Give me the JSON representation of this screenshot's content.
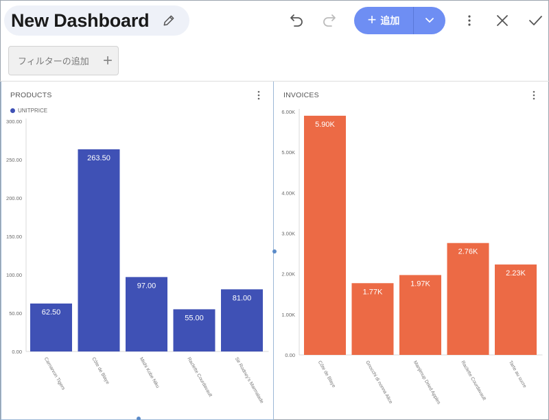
{
  "header": {
    "title": "New Dashboard",
    "add_label": "追加"
  },
  "filter": {
    "label": "フィルターの追加"
  },
  "colors": {
    "products_bar": "#3f51b5",
    "invoices_bar": "#ec6a45",
    "accent": "#6e8ef3"
  },
  "panels": {
    "products": {
      "title": "PRODUCTS",
      "legend": "UNITPRICE"
    },
    "invoices": {
      "title": "INVOICES"
    }
  },
  "chart_data": [
    {
      "type": "bar",
      "title": "PRODUCTS",
      "categories": [
        "Carnarvon Tigers",
        "Côte de Blaye",
        "Mishi Kobe Niku",
        "Raclette Courdavault",
        "Sir Rodney's Marmalade"
      ],
      "series": [
        {
          "name": "UNITPRICE",
          "values": [
            62.5,
            263.5,
            97.0,
            55.0,
            81.0
          ]
        }
      ],
      "data_labels": [
        "62.50",
        "263.50",
        "97.00",
        "55.00",
        "81.00"
      ],
      "yticks": [
        "0.00",
        "50.00",
        "100.00",
        "150.00",
        "200.00",
        "250.00",
        "300.00"
      ],
      "ylim": [
        0,
        300
      ],
      "legend": "top-left",
      "grid": false
    },
    {
      "type": "bar",
      "title": "INVOICES",
      "categories": [
        "Côte de Blaye",
        "Gnocchi di nonna Alice",
        "Manjimup Dried Apples",
        "Raclette Courdavault",
        "Tarte au sucre"
      ],
      "series": [
        {
          "values": [
            5900,
            1770,
            1970,
            2760,
            2230
          ]
        }
      ],
      "data_labels": [
        "5.90K",
        "1.77K",
        "1.97K",
        "2.76K",
        "2.23K"
      ],
      "yticks": [
        "0.00",
        "1.00K",
        "2.00K",
        "3.00K",
        "4.00K",
        "5.00K",
        "6.00K"
      ],
      "ylim": [
        0,
        6000
      ],
      "grid": false
    }
  ]
}
